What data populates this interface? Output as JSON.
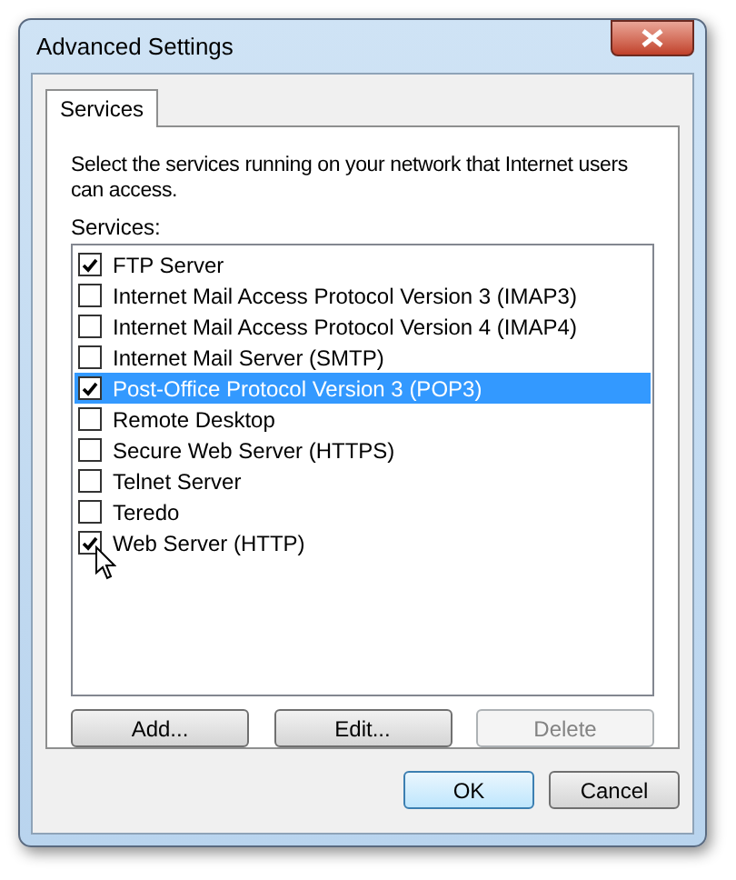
{
  "window": {
    "title": "Advanced Settings"
  },
  "tabs": [
    {
      "label": "Services",
      "selected": true
    }
  ],
  "description": "Select the services running on your network that Internet users can access.",
  "list_label": "Services:",
  "services": [
    {
      "label": "FTP Server",
      "checked": true,
      "selected": false
    },
    {
      "label": "Internet Mail Access Protocol Version 3 (IMAP3)",
      "checked": false,
      "selected": false
    },
    {
      "label": "Internet Mail Access Protocol Version 4 (IMAP4)",
      "checked": false,
      "selected": false
    },
    {
      "label": "Internet Mail Server (SMTP)",
      "checked": false,
      "selected": false
    },
    {
      "label": "Post-Office Protocol Version 3 (POP3)",
      "checked": true,
      "selected": true
    },
    {
      "label": "Remote Desktop",
      "checked": false,
      "selected": false
    },
    {
      "label": "Secure Web Server (HTTPS)",
      "checked": false,
      "selected": false
    },
    {
      "label": "Telnet Server",
      "checked": false,
      "selected": false
    },
    {
      "label": "Teredo",
      "checked": false,
      "selected": false
    },
    {
      "label": "Web Server (HTTP)",
      "checked": true,
      "selected": false
    }
  ],
  "list_buttons": [
    {
      "label": "Add...",
      "disabled": false
    },
    {
      "label": "Edit...",
      "disabled": false
    },
    {
      "label": "Delete",
      "disabled": true
    }
  ],
  "dialog_buttons": [
    {
      "label": "OK",
      "default": true
    },
    {
      "label": "Cancel",
      "default": false
    }
  ]
}
